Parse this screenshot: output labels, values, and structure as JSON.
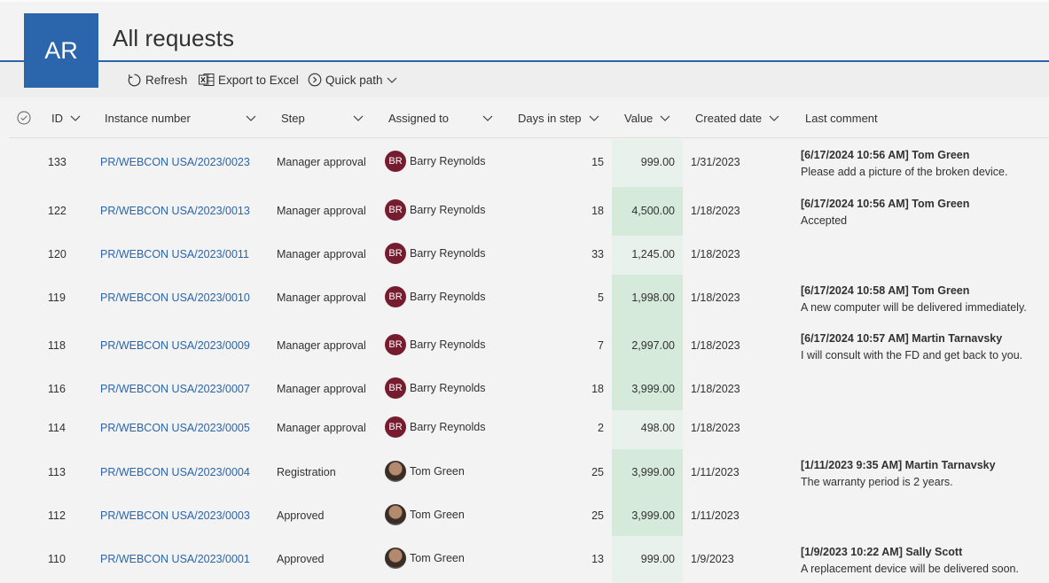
{
  "app": {
    "tile_initials": "AR",
    "title": "All requests"
  },
  "colors": {
    "accent": "#2b65ac",
    "avatar_bg": "#751c2e",
    "value_highlight": "#d5eadb",
    "value_column": "#e9f1ed"
  },
  "toolbar": {
    "refresh_label": "Refresh",
    "export_label": "Export to Excel",
    "quickpath_label": "Quick path"
  },
  "columns": {
    "id": "ID",
    "instance": "Instance number",
    "step": "Step",
    "assigned": "Assigned to",
    "days": "Days in step",
    "value": "Value",
    "created": "Created date",
    "comment": "Last comment"
  },
  "rows": [
    {
      "id": "133",
      "instance": "PR/WEBCON USA/2023/0023",
      "step": "Manager approval",
      "assigned": "Barry Reynolds",
      "avatar": "BR",
      "days": "15",
      "value": "999.00",
      "created": "1/31/2023",
      "comment_head": "[6/17/2024 10:56 AM] Tom Green",
      "comment_text": "Please add a picture of the broken device."
    },
    {
      "id": "122",
      "instance": "PR/WEBCON USA/2023/0013",
      "step": "Manager approval",
      "assigned": "Barry Reynolds",
      "avatar": "BR",
      "days": "18",
      "value": "4,500.00",
      "created": "1/18/2023",
      "comment_head": "[6/17/2024 10:56 AM] Tom Green",
      "comment_text": "Accepted"
    },
    {
      "id": "120",
      "instance": "PR/WEBCON USA/2023/0011",
      "step": "Manager approval",
      "assigned": "Barry Reynolds",
      "avatar": "BR",
      "days": "33",
      "value": "1,245.00",
      "created": "1/18/2023",
      "comment_head": "",
      "comment_text": ""
    },
    {
      "id": "119",
      "instance": "PR/WEBCON USA/2023/0010",
      "step": "Manager approval",
      "assigned": "Barry Reynolds",
      "avatar": "BR",
      "days": "5",
      "value": "1,998.00",
      "created": "1/18/2023",
      "comment_head": "[6/17/2024 10:58 AM] Tom Green",
      "comment_text": "A new computer will be delivered immediately."
    },
    {
      "id": "118",
      "instance": "PR/WEBCON USA/2023/0009",
      "step": "Manager approval",
      "assigned": "Barry Reynolds",
      "avatar": "BR",
      "days": "7",
      "value": "2,997.00",
      "created": "1/18/2023",
      "comment_head": "[6/17/2024 10:57 AM] Martin Tarnavsky",
      "comment_text": "I will consult with the FD and get back to you."
    },
    {
      "id": "116",
      "instance": "PR/WEBCON USA/2023/0007",
      "step": "Manager approval",
      "assigned": "Barry Reynolds",
      "avatar": "BR",
      "days": "18",
      "value": "3,999.00",
      "created": "1/18/2023",
      "comment_head": "",
      "comment_text": ""
    },
    {
      "id": "114",
      "instance": "PR/WEBCON USA/2023/0005",
      "step": "Manager approval",
      "assigned": "Barry Reynolds",
      "avatar": "BR",
      "days": "2",
      "value": "498.00",
      "created": "1/18/2023",
      "comment_head": "",
      "comment_text": ""
    },
    {
      "id": "113",
      "instance": "PR/WEBCON USA/2023/0004",
      "step": "Registration",
      "assigned": "Tom Green",
      "avatar": "",
      "days": "25",
      "value": "3,999.00",
      "created": "1/11/2023",
      "comment_head": "[1/11/2023 9:35 AM] Martin Tarnavsky",
      "comment_text": "The warranty period is 2 years."
    },
    {
      "id": "112",
      "instance": "PR/WEBCON USA/2023/0003",
      "step": "Approved",
      "assigned": "Tom Green",
      "avatar": "",
      "days": "25",
      "value": "3,999.00",
      "created": "1/11/2023",
      "comment_head": "",
      "comment_text": ""
    },
    {
      "id": "110",
      "instance": "PR/WEBCON USA/2023/0001",
      "step": "Approved",
      "assigned": "Tom Green",
      "avatar": "",
      "days": "13",
      "value": "999.00",
      "created": "1/9/2023",
      "comment_head": "[1/9/2023 10:22 AM] Sally Scott",
      "comment_text": "A replacement device will be delivered soon."
    }
  ]
}
